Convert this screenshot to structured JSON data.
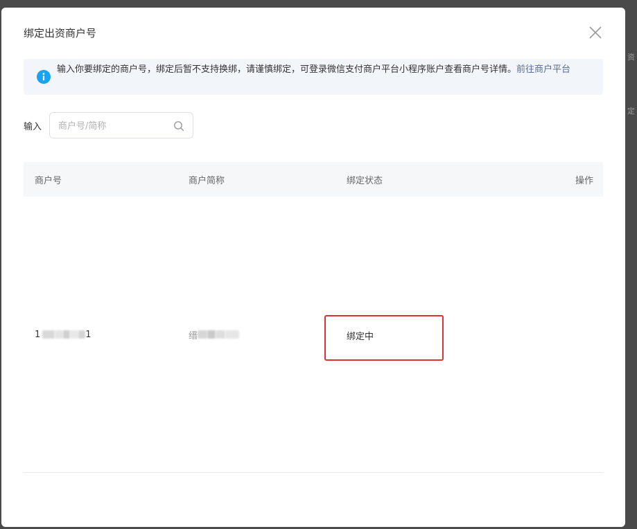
{
  "dialog": {
    "title": "绑定出资商户号",
    "notice": {
      "text": "输入你要绑定的商户号，绑定后暂不支持换绑，请谨慎绑定，可登录微信支付商户平台小程序账户查看商户号详情。",
      "link_label": "前往商户平台"
    },
    "search": {
      "label": "输入",
      "placeholder": "商户号/简称",
      "value": ""
    },
    "table": {
      "columns": [
        "商户号",
        "商户简称",
        "绑定状态",
        "操作"
      ],
      "rows": [
        {
          "merchant_id_visible_start": "1",
          "merchant_id_visible_end": "1",
          "merchant_id_redacted": true,
          "short_name_visible_start": "缙",
          "short_name_redacted": true,
          "status": "绑定中",
          "action": ""
        }
      ]
    }
  },
  "background": {
    "right_fragments": [
      "资",
      "定"
    ]
  },
  "colors": {
    "accent_blue": "#1aa2f5",
    "link": "#576b95",
    "highlight_red": "#e03030",
    "overlay": "#4a4a4a"
  },
  "icons": {
    "close": "close-icon",
    "info": "info-icon",
    "search": "search-icon"
  }
}
